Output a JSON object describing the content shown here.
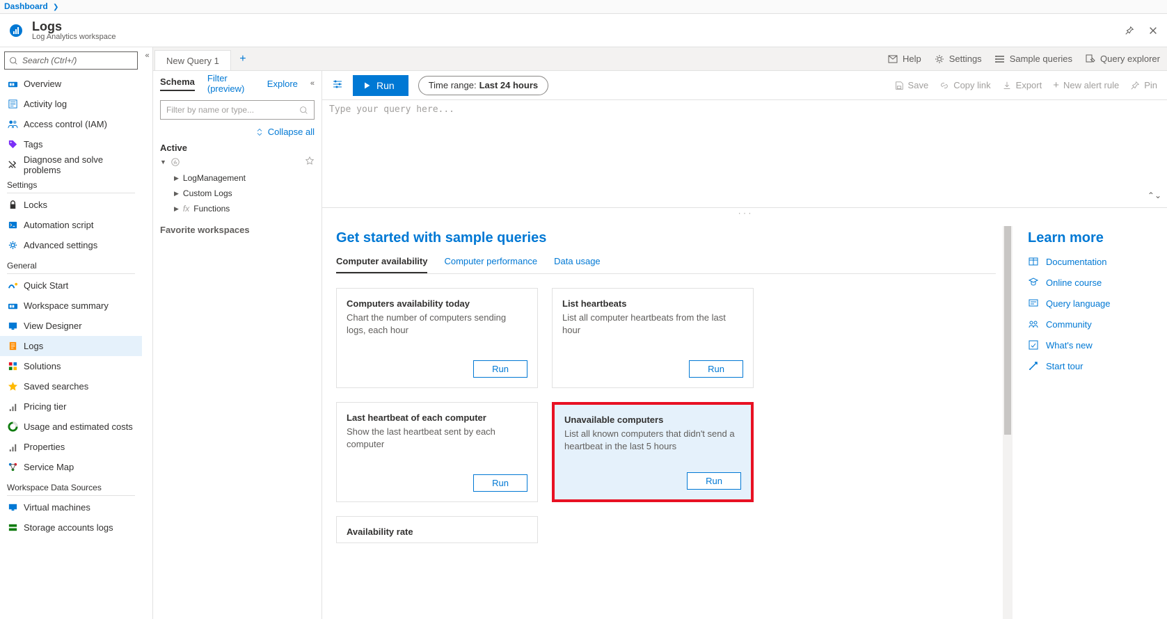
{
  "breadcrumb": {
    "dashboard": "Dashboard"
  },
  "header": {
    "title": "Logs",
    "subtitle": "Log Analytics workspace"
  },
  "sidebar": {
    "search_placeholder": "Search (Ctrl+/)",
    "items_top": [
      {
        "label": "Overview",
        "icon": "overview"
      },
      {
        "label": "Activity log",
        "icon": "activity"
      },
      {
        "label": "Access control (IAM)",
        "icon": "iam"
      },
      {
        "label": "Tags",
        "icon": "tags"
      },
      {
        "label": "Diagnose and solve problems",
        "icon": "diagnose"
      }
    ],
    "section_settings": "Settings",
    "items_settings": [
      {
        "label": "Locks",
        "icon": "lock"
      },
      {
        "label": "Automation script",
        "icon": "script"
      },
      {
        "label": "Advanced settings",
        "icon": "gear"
      }
    ],
    "section_general": "General",
    "items_general": [
      {
        "label": "Quick Start",
        "icon": "quick"
      },
      {
        "label": "Workspace summary",
        "icon": "summary"
      },
      {
        "label": "View Designer",
        "icon": "designer"
      },
      {
        "label": "Logs",
        "icon": "logs",
        "selected": true
      },
      {
        "label": "Solutions",
        "icon": "solutions"
      },
      {
        "label": "Saved searches",
        "icon": "star"
      },
      {
        "label": "Pricing tier",
        "icon": "pricing"
      },
      {
        "label": "Usage and estimated costs",
        "icon": "usage"
      },
      {
        "label": "Properties",
        "icon": "properties"
      },
      {
        "label": "Service Map",
        "icon": "map"
      }
    ],
    "section_datasources": "Workspace Data Sources",
    "items_ds": [
      {
        "label": "Virtual machines",
        "icon": "vm"
      },
      {
        "label": "Storage accounts logs",
        "icon": "storage"
      }
    ]
  },
  "tabs": {
    "newquery": "New Query 1"
  },
  "top_right": {
    "help": "Help",
    "settings": "Settings",
    "sample": "Sample queries",
    "explorer": "Query explorer"
  },
  "schema": {
    "tabs": {
      "schema": "Schema",
      "filter": "Filter (preview)",
      "explore": "Explore"
    },
    "filter_placeholder": "Filter by name or type...",
    "collapse_all": "Collapse all",
    "active": "Active",
    "nodes": [
      {
        "label": "LogManagement"
      },
      {
        "label": "Custom Logs"
      },
      {
        "label": "Functions",
        "fx": true
      }
    ],
    "favorites": "Favorite workspaces"
  },
  "cmdbar": {
    "run": "Run",
    "timerange_label": "Time range:",
    "timerange_value": "Last 24 hours",
    "save": "Save",
    "copy": "Copy link",
    "export": "Export",
    "alert": "New alert rule",
    "pin": "Pin"
  },
  "editor": {
    "placeholder": "Type your query here..."
  },
  "results": {
    "heading": "Get started with sample queries",
    "tabs": {
      "availability": "Computer availability",
      "performance": "Computer performance",
      "usage": "Data usage"
    },
    "cards": [
      {
        "title": "Computers availability today",
        "desc": "Chart the number of computers sending logs, each hour",
        "btn": "Run"
      },
      {
        "title": "List heartbeats",
        "desc": "List all computer heartbeats from the last hour",
        "btn": "Run"
      },
      {
        "title": "Last heartbeat of each computer",
        "desc": "Show the last heartbeat sent by each computer",
        "btn": "Run"
      },
      {
        "title": "Unavailable computers",
        "desc": "List all known computers that didn't send a heartbeat in the last 5 hours",
        "btn": "Run",
        "highlight": true
      },
      {
        "title": "Availability rate",
        "desc": ""
      }
    ]
  },
  "learn": {
    "heading": "Learn more",
    "links": [
      {
        "label": "Documentation"
      },
      {
        "label": "Online course"
      },
      {
        "label": "Query language"
      },
      {
        "label": "Community"
      },
      {
        "label": "What's new"
      },
      {
        "label": "Start tour"
      }
    ]
  }
}
